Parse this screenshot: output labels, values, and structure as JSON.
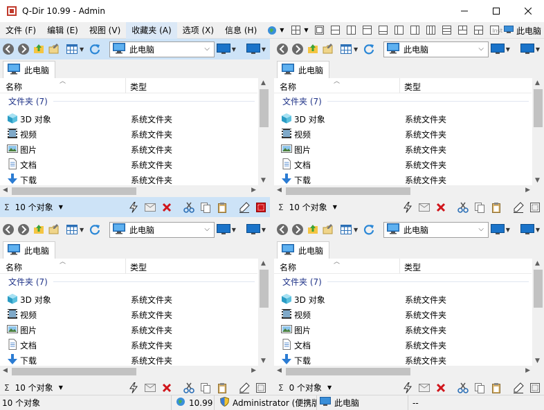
{
  "window": {
    "title": "Q-Dir 10.99 - Admin",
    "controls": [
      "minimize",
      "maximize",
      "close"
    ]
  },
  "menu": {
    "items": [
      "文件 (F)",
      "编辑 (E)",
      "视图 (V)",
      "收藏夹 (A)",
      "选项 (X)",
      "信息 (H)"
    ],
    "active_index": 3,
    "right_label": "此电脑",
    "right_small": "Inst"
  },
  "panes": [
    {
      "active": true,
      "address": "此电脑",
      "tab": "此电脑",
      "columns": [
        "名称",
        "类型"
      ],
      "group": "文件夹 (7)",
      "rows": [
        {
          "name": "3D 对象",
          "type": "系统文件夹",
          "icon": "cube-3d-icon"
        },
        {
          "name": "视频",
          "type": "系统文件夹",
          "icon": "video-folder-icon"
        },
        {
          "name": "图片",
          "type": "系统文件夹",
          "icon": "pictures-folder-icon"
        },
        {
          "name": "文档",
          "type": "系统文件夹",
          "icon": "documents-folder-icon"
        },
        {
          "name": "下载",
          "type": "系统文件夹",
          "icon": "download-folder-icon"
        }
      ],
      "status": "10 个对象"
    },
    {
      "active": false,
      "address": "此电脑",
      "tab": "此电脑",
      "columns": [
        "名称",
        "类型"
      ],
      "group": "文件夹 (7)",
      "rows": [
        {
          "name": "3D 对象",
          "type": "系统文件夹",
          "icon": "cube-3d-icon"
        },
        {
          "name": "视频",
          "type": "系统文件夹",
          "icon": "video-folder-icon"
        },
        {
          "name": "图片",
          "type": "系统文件夹",
          "icon": "pictures-folder-icon"
        },
        {
          "name": "文档",
          "type": "系统文件夹",
          "icon": "documents-folder-icon"
        },
        {
          "name": "下载",
          "type": "系统文件夹",
          "icon": "download-folder-icon"
        }
      ],
      "status": "10 个对象"
    },
    {
      "active": false,
      "address": "此电脑",
      "tab": "此电脑",
      "columns": [
        "名称",
        "类型"
      ],
      "group": "文件夹 (7)",
      "rows": [
        {
          "name": "3D 对象",
          "type": "系统文件夹",
          "icon": "cube-3d-icon"
        },
        {
          "name": "视频",
          "type": "系统文件夹",
          "icon": "video-folder-icon"
        },
        {
          "name": "图片",
          "type": "系统文件夹",
          "icon": "pictures-folder-icon"
        },
        {
          "name": "文档",
          "type": "系统文件夹",
          "icon": "documents-folder-icon"
        },
        {
          "name": "下载",
          "type": "系统文件夹",
          "icon": "download-folder-icon"
        }
      ],
      "status": "10 个对象"
    },
    {
      "active": false,
      "address": "此电脑",
      "tab": "此电脑",
      "columns": [
        "名称",
        "类型"
      ],
      "group": "文件夹 (7)",
      "rows": [
        {
          "name": "3D 对象",
          "type": "系统文件夹",
          "icon": "cube-3d-icon"
        },
        {
          "name": "视频",
          "type": "系统文件夹",
          "icon": "video-folder-icon"
        },
        {
          "name": "图片",
          "type": "系统文件夹",
          "icon": "pictures-folder-icon"
        },
        {
          "name": "文档",
          "type": "系统文件夹",
          "icon": "documents-folder-icon"
        },
        {
          "name": "下载",
          "type": "系统文件夹",
          "icon": "download-folder-icon"
        }
      ],
      "status": "0 个对象"
    }
  ],
  "statusbar": {
    "objects": "10 个对象",
    "version": "10.99",
    "user": "Administrator (便携版)",
    "location": "此电脑",
    "extra": "--"
  },
  "colors": {
    "active_pane": "#cde3f7",
    "chrome": "#f0f0f0",
    "group_text": "#1e3287",
    "delete_red": "#d0151b"
  }
}
